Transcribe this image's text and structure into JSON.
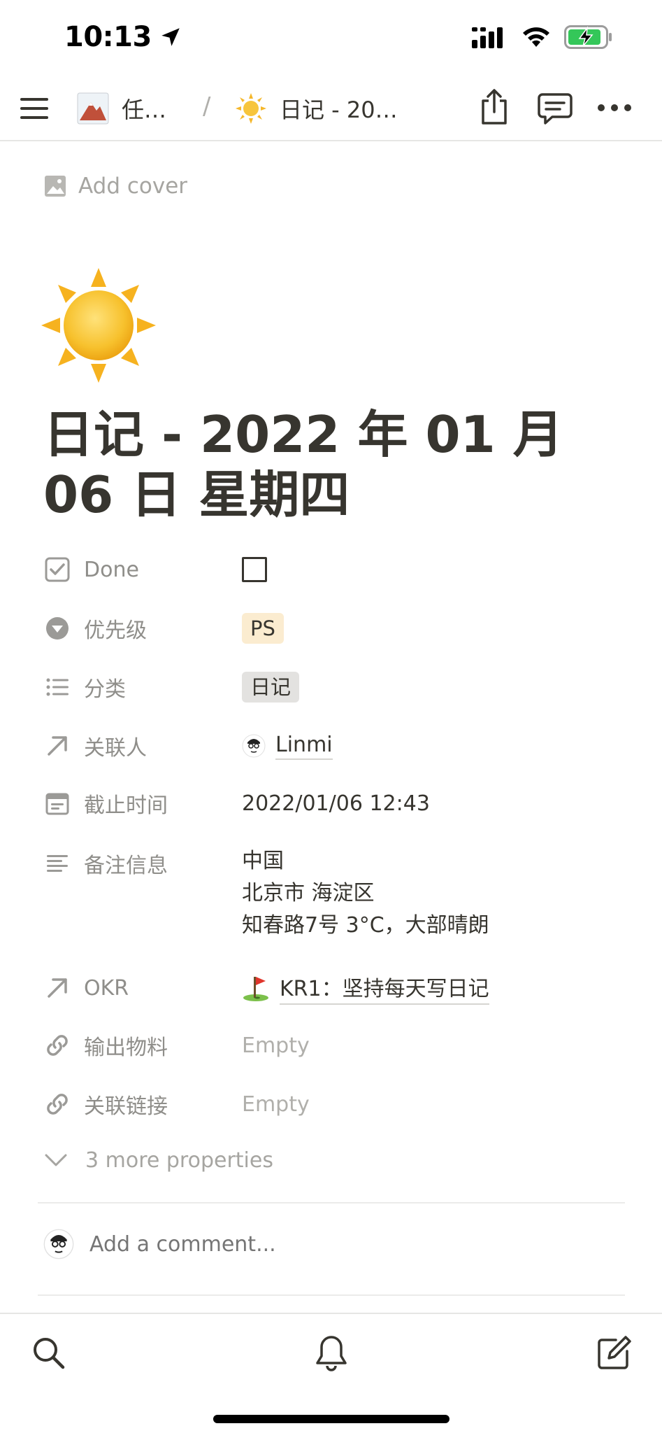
{
  "status_bar": {
    "time": "10:13"
  },
  "nav": {
    "breadcrumb_parent": "任…",
    "separator": "/",
    "breadcrumb_current": "日记 - 20…"
  },
  "cover": {
    "add_cover_label": "Add cover"
  },
  "page": {
    "icon": "sun-emoji",
    "title": "日记 - 2022 年 01 月 06 日 星期四"
  },
  "properties": {
    "done": {
      "label": "Done",
      "checked": false
    },
    "priority": {
      "label": "优先级",
      "value": "PS"
    },
    "category": {
      "label": "分类",
      "value": "日记"
    },
    "person": {
      "label": "关联人",
      "value": "Linmi"
    },
    "deadline": {
      "label": "截止时间",
      "value": "2022/01/06 12:43"
    },
    "notes": {
      "label": "备注信息",
      "lines": [
        "中国",
        "北京市 海淀区",
        "知春路7号 3°C，大部晴朗"
      ]
    },
    "okr": {
      "label": "OKR",
      "value": "KR1：坚持每天写日记"
    },
    "output": {
      "label": "输出物料",
      "value": "Empty"
    },
    "links": {
      "label": "关联链接",
      "value": "Empty"
    },
    "more": {
      "label": "3 more properties"
    }
  },
  "comment": {
    "placeholder": "Add a comment..."
  },
  "colors": {
    "text": "#37352f",
    "muted": "#8f8e8a",
    "tag_ps_bg": "#fbecd0",
    "tag_diary_bg": "#e3e2e0",
    "battery_green": "#34c759"
  }
}
